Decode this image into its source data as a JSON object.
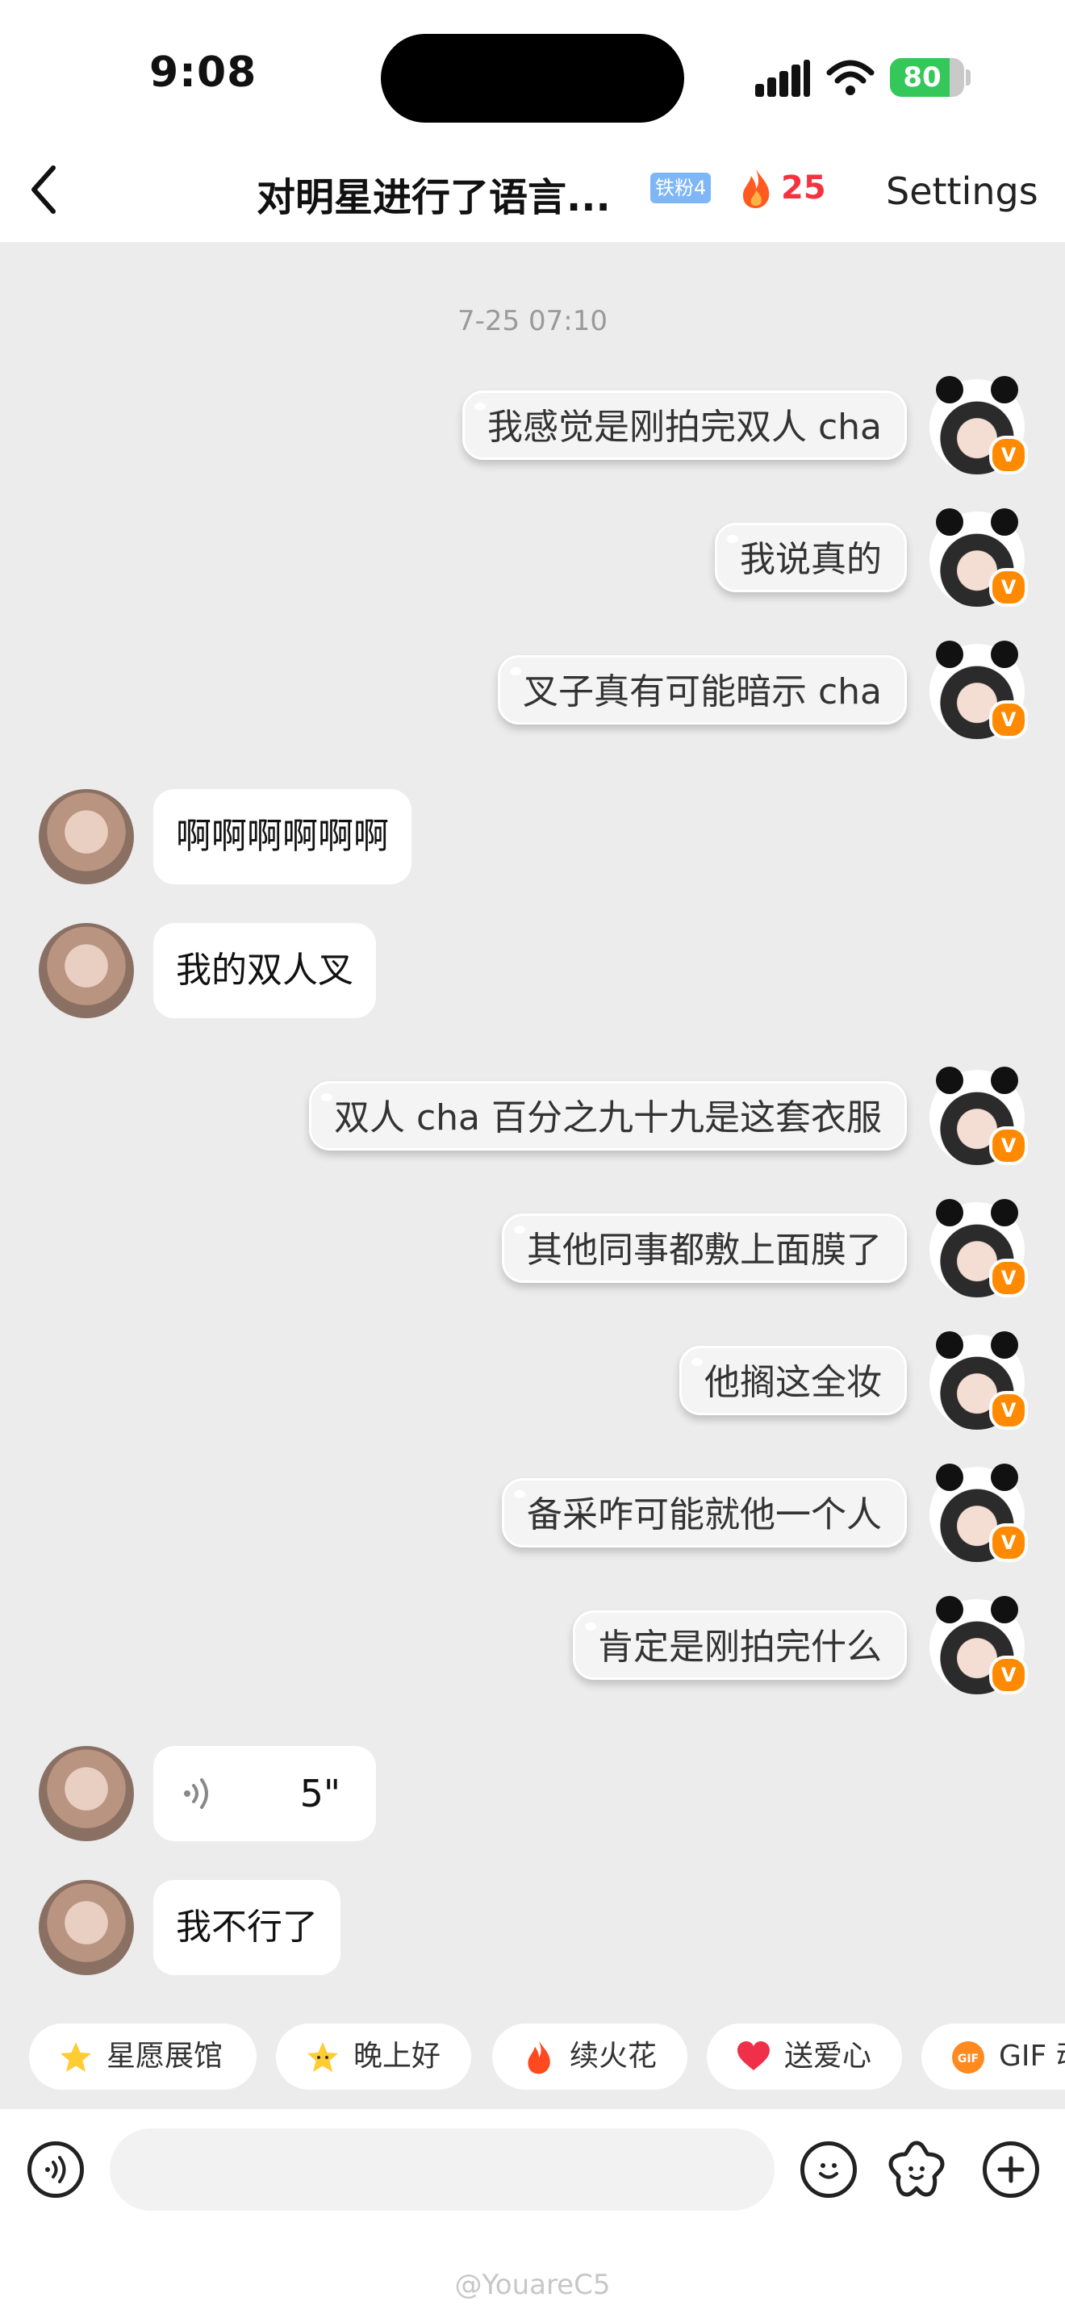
{
  "status_bar": {
    "time": "9:08",
    "battery": "80"
  },
  "header": {
    "title": "对明星进行了语言...",
    "fan_badge": "铁粉4",
    "streak": "25",
    "settings_label": "Settings"
  },
  "timestamp": "7-25 07:10",
  "messages": [
    {
      "side": "right",
      "text": "我感觉是刚拍完双人 cha"
    },
    {
      "side": "right",
      "text": "我说真的"
    },
    {
      "side": "right",
      "text": "叉子真有可能暗示 cha"
    },
    {
      "side": "left",
      "text": "啊啊啊啊啊啊"
    },
    {
      "side": "left",
      "text": "我的双人叉"
    },
    {
      "side": "right",
      "text": "双人 cha 百分之九十九是这套衣服"
    },
    {
      "side": "right",
      "text": "其他同事都敷上面膜了"
    },
    {
      "side": "right",
      "text": "他搁这全妆"
    },
    {
      "side": "right",
      "text": "备采咋可能就他一个人"
    },
    {
      "side": "right",
      "text": "肯定是刚拍完什么"
    },
    {
      "side": "left",
      "type": "voice",
      "text": "5\""
    },
    {
      "side": "left",
      "text": "我不行了"
    }
  ],
  "badges": {
    "verified": "V"
  },
  "quick_replies": [
    {
      "label": "星愿展馆",
      "icon": "star-icon"
    },
    {
      "label": "晚上好",
      "icon": "smiling-star-icon"
    },
    {
      "label": "续火花",
      "icon": "fire-icon"
    },
    {
      "label": "送爱心",
      "icon": "heart-icon"
    },
    {
      "label": "GIF 动",
      "icon": "gif-icon"
    }
  ],
  "watermark": "@YouareC5",
  "colors": {
    "streak": "#f5333f",
    "battery": "#34c759",
    "badge": "#ff8a00",
    "fan_badge": "#7eb6f6"
  }
}
